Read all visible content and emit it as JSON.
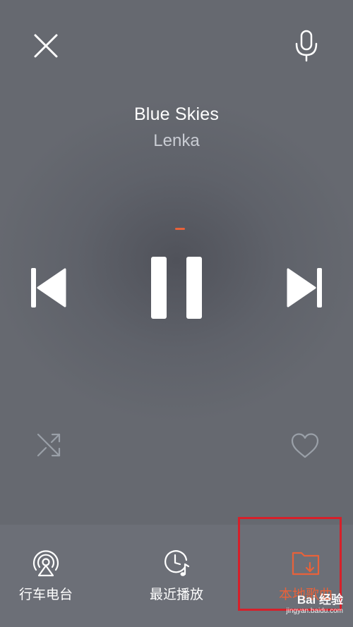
{
  "player": {
    "title": "Blue Skies",
    "artist": "Lenka",
    "progress_color": "#e8623a"
  },
  "controls": {
    "close_icon": "close-icon",
    "mic_icon": "microphone-icon",
    "prev_icon": "skip-previous-icon",
    "pause_icon": "pause-icon",
    "next_icon": "skip-next-icon",
    "shuffle_icon": "shuffle-icon",
    "like_icon": "heart-outline-icon"
  },
  "bottom_nav": {
    "items": [
      {
        "label": "行车电台",
        "icon": "car-radio-icon",
        "active": false
      },
      {
        "label": "最近播放",
        "icon": "recent-clock-icon",
        "active": false
      },
      {
        "label": "本地歌曲",
        "icon": "folder-download-icon",
        "active": true
      }
    ],
    "active_color": "#e8623a"
  },
  "watermark": {
    "main": "Bai 经验",
    "sub": "jingyan.baidu.com"
  }
}
